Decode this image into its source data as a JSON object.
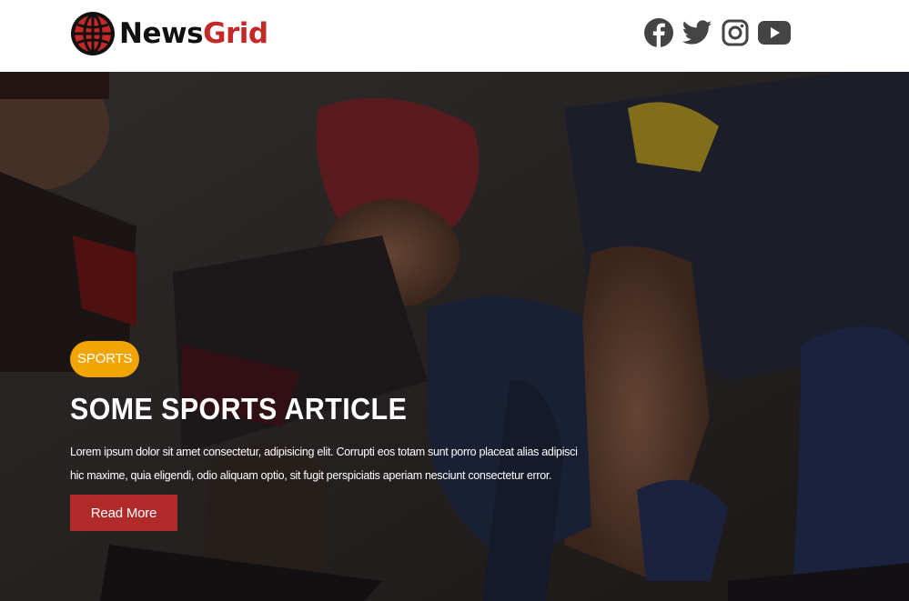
{
  "brand": {
    "name_part1": "News",
    "name_part2": "Grid",
    "accent": "#c62828"
  },
  "social": [
    {
      "name": "facebook-icon"
    },
    {
      "name": "twitter-icon"
    },
    {
      "name": "instagram-icon"
    },
    {
      "name": "youtube-icon"
    }
  ],
  "hero": {
    "category": "SPORTS",
    "category_color": "#f0a500",
    "title": "SOME SPORTS ARTICLE",
    "body": "Lorem ipsum dolor sit amet consectetur, adipisicing elit. Corrupti eos totam sunt porro placeat alias adipisci hic maxime, quia eligendi, odio aliquam optio, sit fugit perspiciatis aperiam nesciunt consectetur error.",
    "button_label": "Read More",
    "button_color": "#b02a2a"
  }
}
